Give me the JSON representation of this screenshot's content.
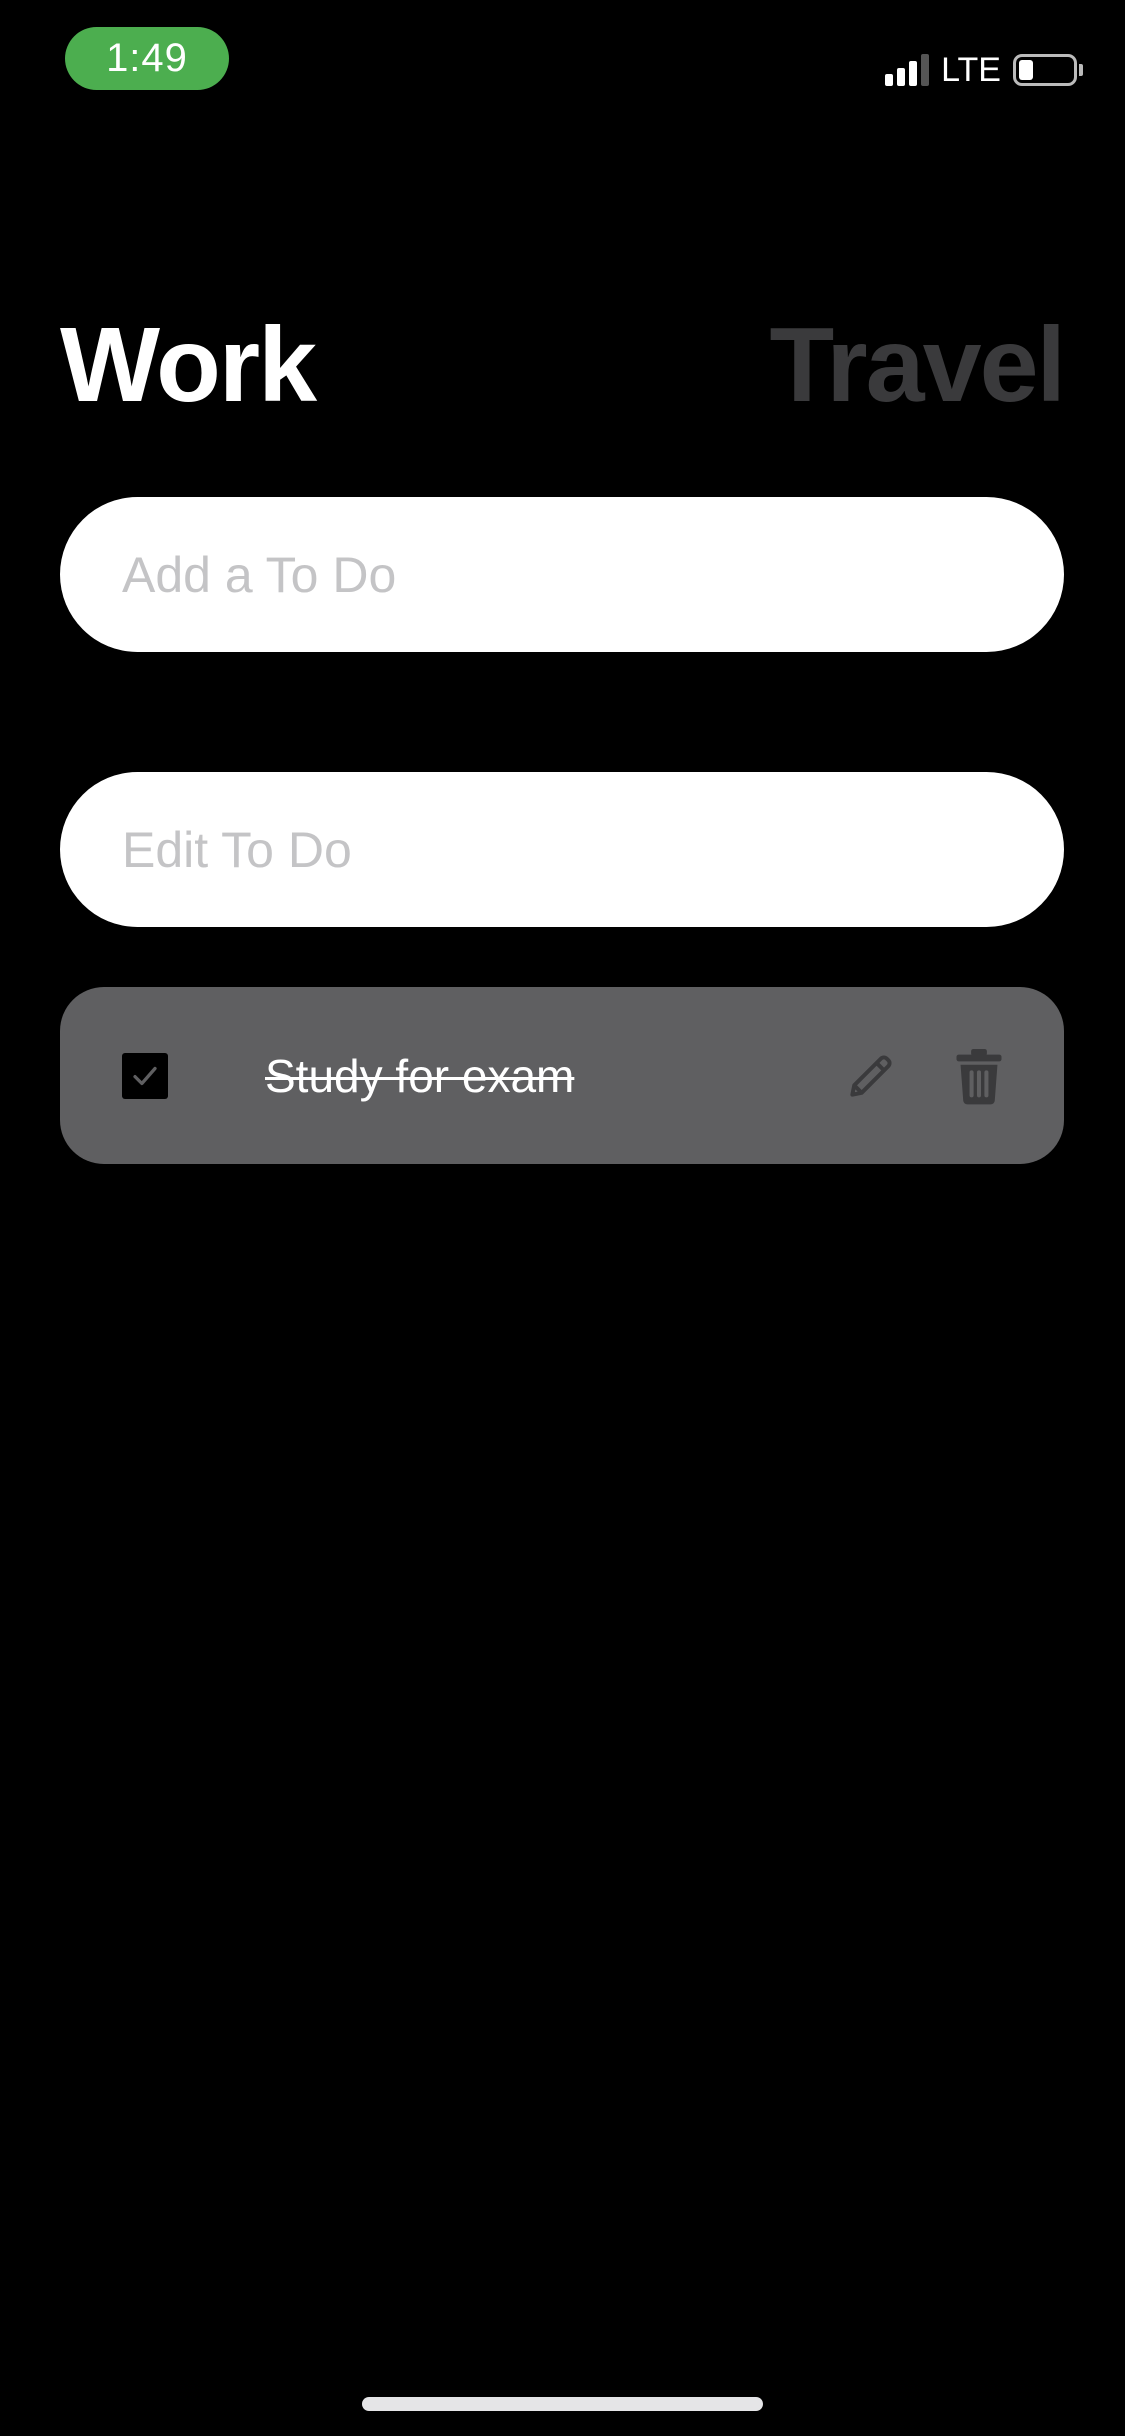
{
  "status_bar": {
    "time": "1:49",
    "network": "LTE",
    "signal_bars": 3,
    "signal_bars_total": 4,
    "battery_level": 0.2,
    "time_pill_color": "#4cae4f"
  },
  "tabs": [
    {
      "label": "Work",
      "active": true
    },
    {
      "label": "Travel",
      "active": false
    }
  ],
  "inputs": {
    "add": {
      "placeholder": "Add a To Do",
      "value": ""
    },
    "edit": {
      "placeholder": "Edit To Do",
      "value": ""
    }
  },
  "todos": [
    {
      "text": "Study for exam",
      "completed": true,
      "edit_icon": "pencil-icon",
      "delete_icon": "trash-icon"
    }
  ],
  "colors": {
    "background": "#000000",
    "active_tab": "#ffffff",
    "inactive_tab": "#3a3a3c",
    "todo_background": "#5f5f61",
    "icon_color": "#3a3a3c"
  }
}
